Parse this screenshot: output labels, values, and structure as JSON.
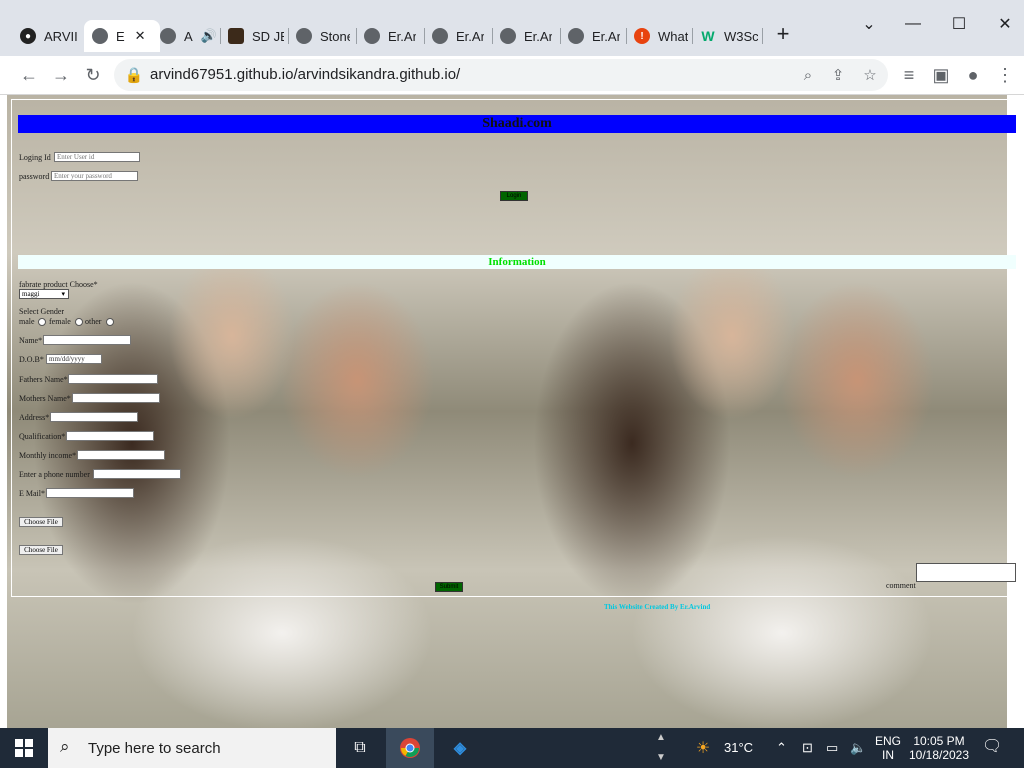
{
  "browser": {
    "tabs": [
      {
        "label": "ARVII",
        "icon": "github-icon"
      },
      {
        "label": "E",
        "icon": "globe-icon",
        "active": true
      },
      {
        "label": "A",
        "icon": "globe-icon"
      },
      {
        "label": "SD JE",
        "icon": "site-icon"
      },
      {
        "label": "Stone",
        "icon": "globe-icon"
      },
      {
        "label": "Er.Ar",
        "icon": "globe-icon"
      },
      {
        "label": "Er.Ar",
        "icon": "globe-icon"
      },
      {
        "label": "Er.Ar",
        "icon": "globe-icon"
      },
      {
        "label": "Er.Ar",
        "icon": "globe-icon"
      },
      {
        "label": "What",
        "icon": "alert-icon"
      },
      {
        "label": "W3Sc",
        "icon": "w3schools-icon"
      }
    ],
    "close_tab_glyph": "✕",
    "new_tab_glyph": "+",
    "url": "arvind67951.github.io/arvindsikandra.github.io/"
  },
  "page": {
    "site_title": "Shaadi.com",
    "login": {
      "login_id_label": "Loging Id",
      "login_id_placeholder": "Enter User id",
      "password_label": "password",
      "password_placeholder": "Enter your password",
      "login_button": "Login"
    },
    "info_title": "Information",
    "form": {
      "product_label": "fabrate product Choose*",
      "product_selected": "maggi",
      "gender_label": "Select Gender",
      "gender_options": [
        "male",
        "female",
        "other"
      ],
      "name_label": "Name*",
      "dob_label": "D.O.B*",
      "dob_placeholder": "mm/dd/yyyy",
      "fathers_name_label": "Fathers Name*",
      "mothers_name_label": "Mothers Name*",
      "address_label": "Address*",
      "qualification_label": "Qualification*",
      "monthly_income_label": "Monthly income*",
      "phone_label": "Enter a phone number",
      "email_label": "E Mail*",
      "file_button_1": "Choose File",
      "file_button_2": "Choose File",
      "submit_button": "Submit",
      "comment_label": "comment"
    },
    "footer_credit": "This Website Created By Er.Arvind"
  },
  "taskbar": {
    "search_placeholder": "Type here to search",
    "weather": "31°C",
    "language_line1": "ENG",
    "language_line2": "IN",
    "time": "10:05 PM",
    "date": "10/18/2023"
  }
}
